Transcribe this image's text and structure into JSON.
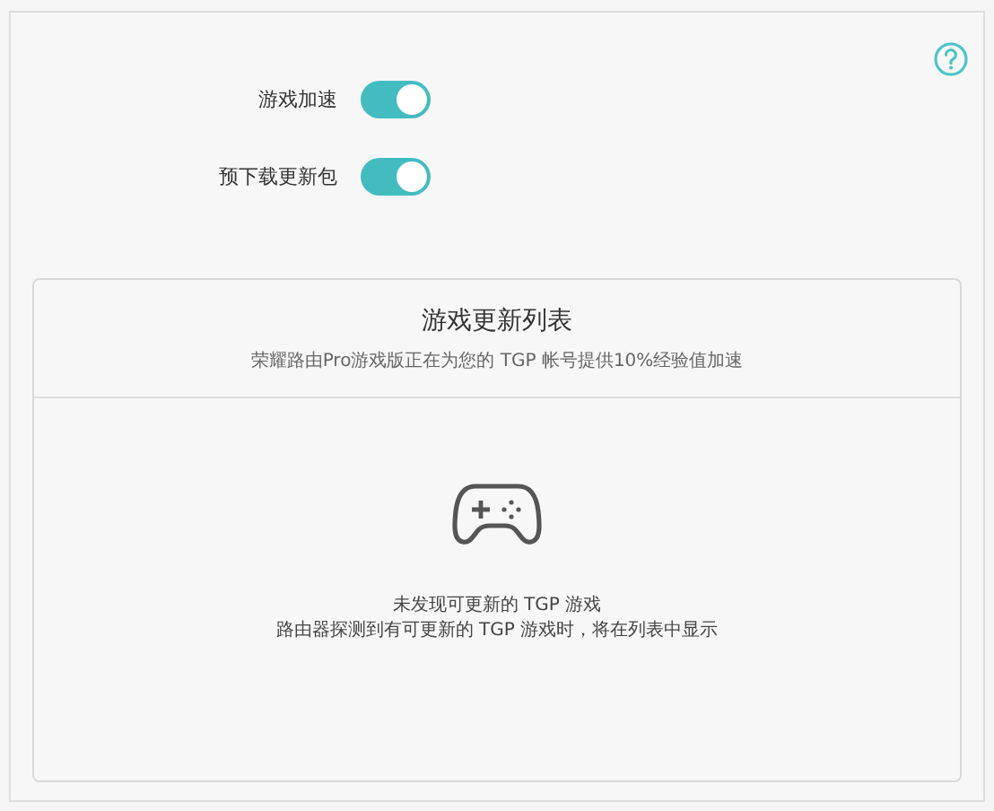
{
  "settings": [
    {
      "label": "游戏加速",
      "on": true
    },
    {
      "label": "预下载更新包",
      "on": true
    }
  ],
  "update_list": {
    "title": "游戏更新列表",
    "subtitle": "荣耀路由Pro游戏版正在为您的 TGP 帐号提供10%经验值加速",
    "empty_title": "未发现可更新的 TGP 游戏",
    "empty_hint": "路由器探测到有可更新的 TGP 游戏时，将在列表中显示"
  }
}
